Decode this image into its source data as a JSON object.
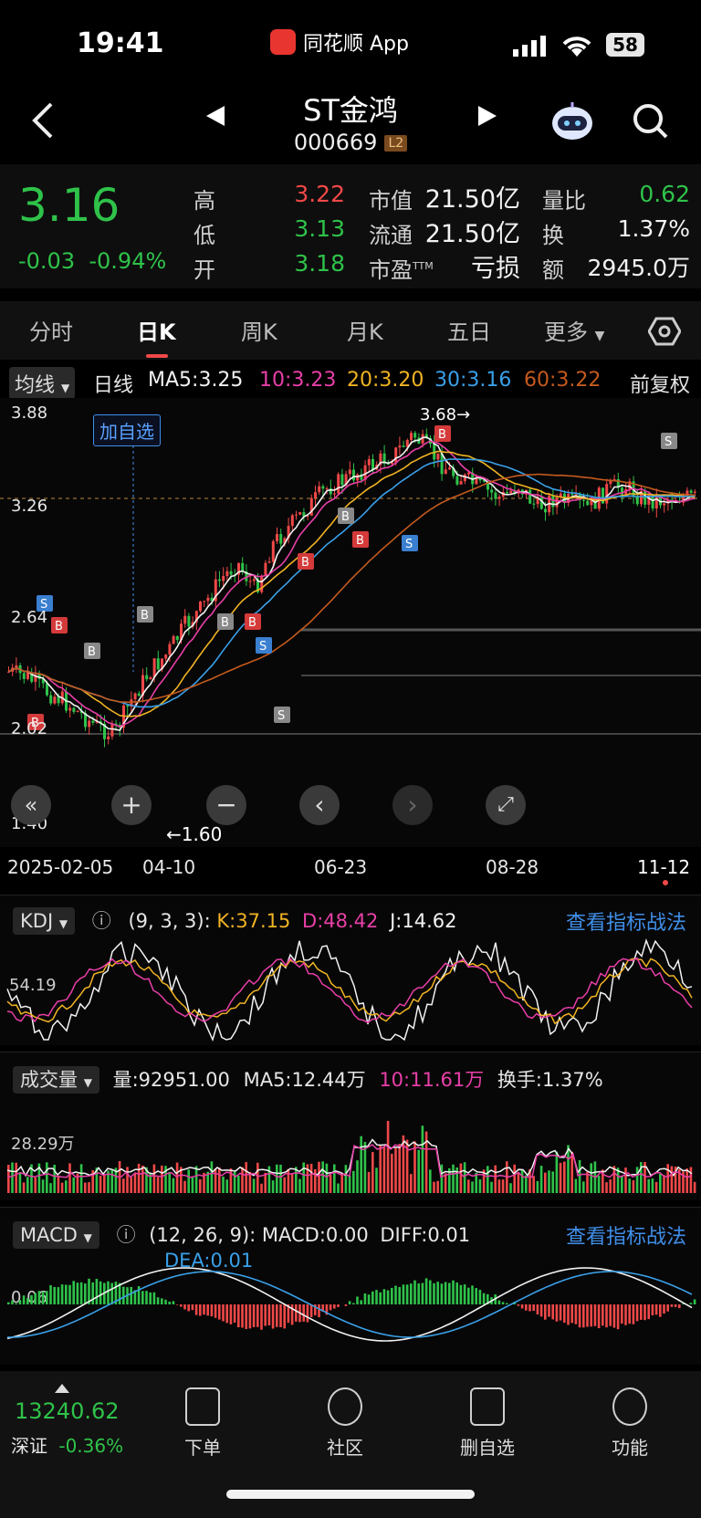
{
  "status": {
    "time": "19:41",
    "app_name": "同花顺 App",
    "battery": "58"
  },
  "title": {
    "name": "ST金鸿",
    "code": "000669",
    "level": "L2"
  },
  "quote": {
    "price": "3.16",
    "change": "-0.03",
    "change_pct": "-0.94%",
    "high_label": "高",
    "high": "3.22",
    "low_label": "低",
    "low": "3.13",
    "open_label": "开",
    "open": "3.18",
    "mktcap_label": "市值",
    "mktcap": "21.50亿",
    "float_label": "流通",
    "float": "21.50亿",
    "pe_label": "市盈",
    "pe_sup": "TTM",
    "pe": "亏损",
    "vol_ratio_label": "量比",
    "vol_ratio": "0.62",
    "turnover_label": "换",
    "turnover": "1.37%",
    "amount_label": "额",
    "amount": "2945.0万"
  },
  "tabs": [
    "分时",
    "日K",
    "周K",
    "月K",
    "五日",
    "更多"
  ],
  "active_tab": "日K",
  "ma_bar": {
    "selector": "均线",
    "period": "日线",
    "ma5": "MA5:3.25",
    "ma10": "10:3.23",
    "ma20": "20:3.20",
    "ma30": "30:3.16",
    "ma60": "60:3.22",
    "adjust": "前复权",
    "colors": {
      "ma5": "#f2f2f2",
      "ma10": "#e83fa8",
      "ma20": "#f0b323",
      "ma30": "#3aa0e8",
      "ma60": "#c45a1e"
    }
  },
  "kline": {
    "y_ticks": [
      "3.88",
      "3.26",
      "2.64",
      "2.02",
      "1.40"
    ],
    "x_ticks": [
      "2025-02-05",
      "04-10",
      "06-23",
      "08-28",
      "11-12"
    ],
    "high_marker": "3.68→",
    "low_marker": "←1.60",
    "add_watch_tag": "加自选",
    "controls": [
      "«",
      "+",
      "−",
      "‹",
      "›",
      "⤢"
    ]
  },
  "kdj": {
    "selector": "KDJ",
    "params": "(9, 3, 3):",
    "k": "K:37.15",
    "d": "D:48.42",
    "j": "J:14.62",
    "link": "查看指标战法",
    "level": "54.19"
  },
  "volume": {
    "selector": "成交量",
    "vol": "量:92951.00",
    "ma5": "MA5:12.44万",
    "ma10": "10:11.61万",
    "turnover": "换手:1.37%",
    "level": "28.29万"
  },
  "macd": {
    "selector": "MACD",
    "params": "(12, 26, 9):",
    "macd": "MACD:0.00",
    "diff": "DIFF:0.01",
    "dea": "DEA:0.01",
    "link": "查看指标战法",
    "level": "0.06"
  },
  "bottom": {
    "index_value": "13240.62",
    "index_name": "深证",
    "index_change": "-0.36%",
    "nav": [
      "下单",
      "社区",
      "删自选",
      "功能"
    ]
  }
}
